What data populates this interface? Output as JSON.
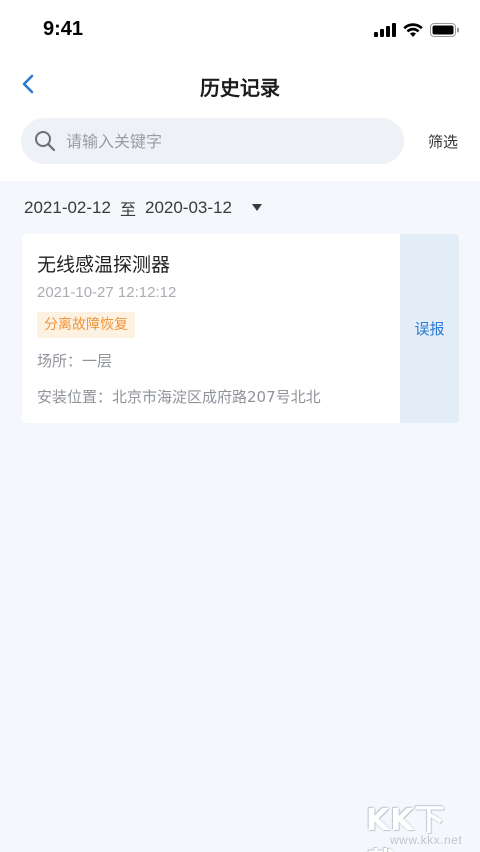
{
  "status_bar": {
    "time": "9:41",
    "icons": [
      "cellular-signal-icon",
      "wifi-icon",
      "battery-icon"
    ]
  },
  "nav": {
    "title": "历史记录",
    "back_icon": "chevron-left-icon"
  },
  "search": {
    "placeholder": "请输入关键字",
    "value": "",
    "icon": "search-icon"
  },
  "filter": {
    "label": "筛选"
  },
  "date_range": {
    "start": "2021-02-12",
    "separator": "至",
    "end": "2020-03-12",
    "icon": "caret-down-icon"
  },
  "records": [
    {
      "device_name": "无线感温探测器",
      "time": "2021-10-27 12:12:12",
      "status_badge": "分离故障恢复",
      "location": "场所：一层",
      "address": "安装位置：北京市海淀区成府路207号北北",
      "action_label": "误报"
    }
  ],
  "watermark": {
    "logo_text": "KK下载",
    "url": "www.kkx.net"
  },
  "colors": {
    "accent": "#2a7ad6",
    "badge_text": "#f0963a",
    "badge_bg": "#fdf1e2",
    "page_bg": "#f4f7fb",
    "action_bg": "#e3edf8"
  }
}
